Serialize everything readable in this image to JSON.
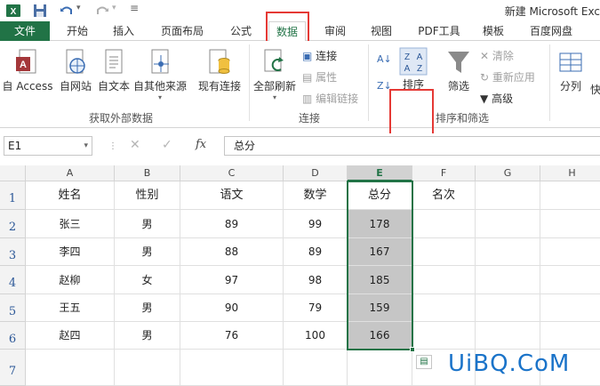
{
  "window": {
    "title": "新建 Microsoft Exc"
  },
  "quick_access": {
    "icons": [
      "excel-logo-icon",
      "save-icon",
      "undo-icon",
      "redo-icon",
      "customize-icon"
    ]
  },
  "tabs": [
    "文件",
    "开始",
    "插入",
    "页面布局",
    "公式",
    "数据",
    "审阅",
    "视图",
    "PDF工具",
    "模板",
    "百度网盘"
  ],
  "active_tab": "数据",
  "ribbon": {
    "get_external": {
      "buttons": [
        "自 Access",
        "自网站",
        "自文本",
        "自其他来源",
        "现有连接"
      ],
      "group": "获取外部数据"
    },
    "connections": {
      "refresh_all": "全部刷新",
      "small": [
        "连接",
        "属性",
        "编辑链接"
      ],
      "group": "连接"
    },
    "sort_filter": {
      "sort": "排序",
      "filter": "筛选",
      "small": [
        "清除",
        "重新应用",
        "高级"
      ],
      "group": "排序和筛选"
    },
    "data_tools": {
      "split": "分列",
      "fast": "快"
    }
  },
  "formula_bar": {
    "name_box": "E1",
    "fx": "fx",
    "content": "总分"
  },
  "sheet": {
    "columns": [
      "A",
      "B",
      "C",
      "D",
      "E",
      "F",
      "G",
      "H"
    ],
    "rows": [
      "1",
      "2",
      "3",
      "4",
      "5",
      "6",
      "7"
    ],
    "cells": [
      [
        "姓名",
        "性别",
        "语文",
        "数学",
        "总分",
        "名次"
      ],
      [
        "张三",
        "男",
        "89",
        "99",
        "178",
        ""
      ],
      [
        "李四",
        "男",
        "88",
        "89",
        "167",
        ""
      ],
      [
        "赵柳",
        "女",
        "97",
        "98",
        "185",
        ""
      ],
      [
        "王五",
        "男",
        "90",
        "79",
        "159",
        ""
      ],
      [
        "赵四",
        "男",
        "76",
        "100",
        "166",
        ""
      ]
    ],
    "selected_column": "E"
  },
  "watermark": "UiBQ.CoM",
  "colors": {
    "excel_green": "#217346",
    "highlight_red": "#e53935",
    "selection_gray": "#c6c6c6"
  }
}
